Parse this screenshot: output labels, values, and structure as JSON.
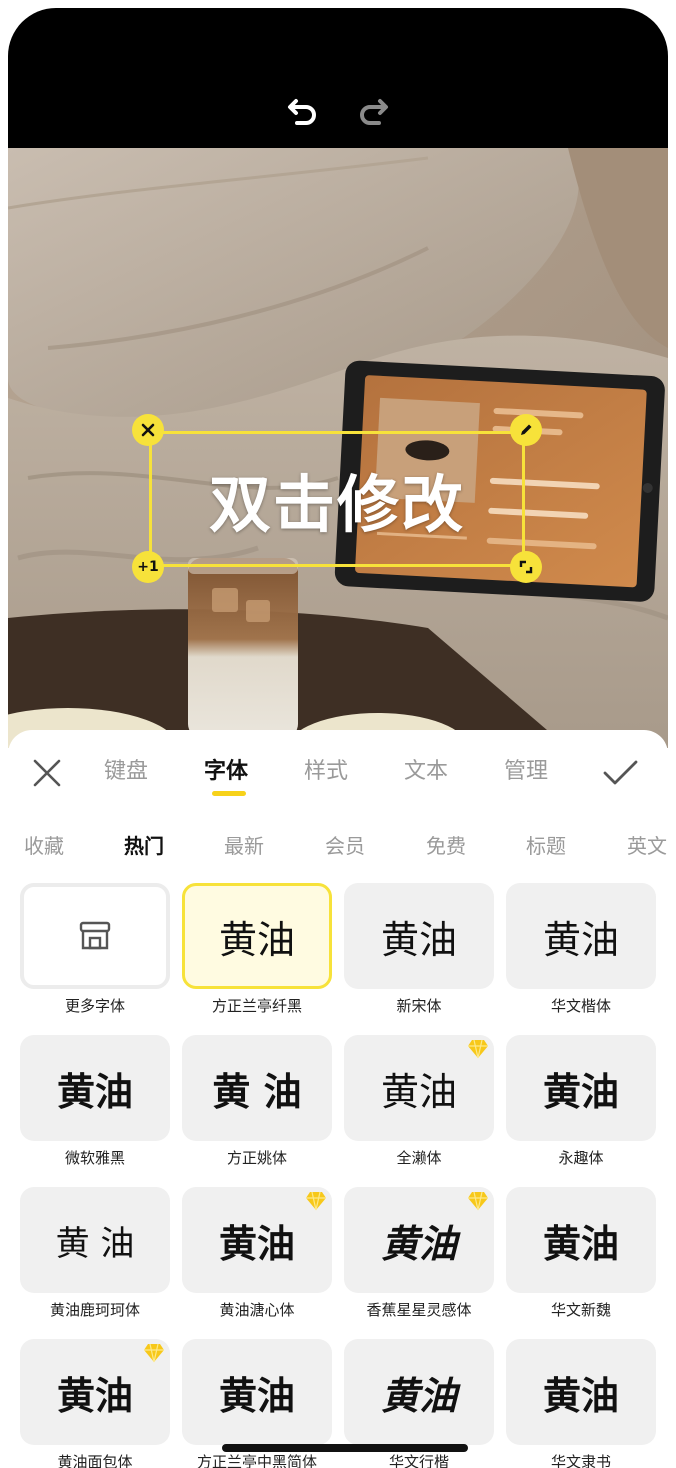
{
  "canvas_text": "双击修改",
  "handles": {
    "plus_label": "+1"
  },
  "tabs": {
    "keyboard": "键盘",
    "font": "字体",
    "style": "样式",
    "text": "文本",
    "manage": "管理"
  },
  "categories": [
    "收藏",
    "热门",
    "最新",
    "会员",
    "免费",
    "标题",
    "英文"
  ],
  "fonts": [
    {
      "preview": "",
      "name": "更多字体",
      "icon": "shop-icon"
    },
    {
      "preview": "黄油",
      "name": "方正兰亭纤黑",
      "selected": true
    },
    {
      "preview": "黄油",
      "name": "新宋体"
    },
    {
      "preview": "黄油",
      "name": "华文楷体"
    },
    {
      "preview": "黄油",
      "name": "微软雅黑"
    },
    {
      "preview": "黄 油",
      "name": "方正姚体"
    },
    {
      "preview": "黄油",
      "name": "全濑体",
      "vip": true
    },
    {
      "preview": "黄油",
      "name": "永趣体"
    },
    {
      "preview": "黄 油",
      "name": "黄油鹿珂珂体"
    },
    {
      "preview": "黄油",
      "name": "黄油溏心体",
      "vip": true
    },
    {
      "preview": "黄油",
      "name": "香蕉星星灵感体",
      "vip": true
    },
    {
      "preview": "黄油",
      "name": "华文新魏"
    },
    {
      "preview": "黄油",
      "name": "黄油面包体",
      "vip": true
    },
    {
      "preview": "黄油",
      "name": "方正兰亭中黑简体"
    },
    {
      "preview": "黄油",
      "name": "华文行楷"
    },
    {
      "preview": "黄油",
      "name": "华文隶书"
    }
  ],
  "colors": {
    "accent": "#f7e23a",
    "vip": "#f7c81a"
  }
}
